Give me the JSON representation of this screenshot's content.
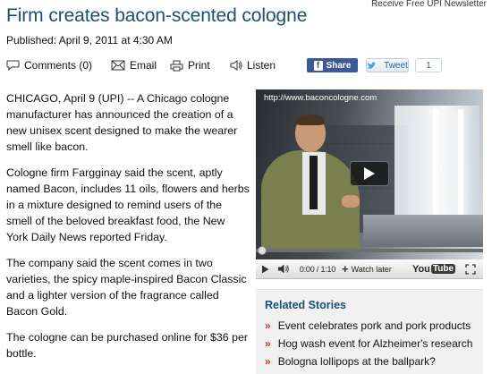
{
  "header": {
    "top_link": "Receive Free UPI Newsletter",
    "headline": "Firm creates bacon-scented cologne",
    "published": "Published: April 9, 2011 at 4:30 AM"
  },
  "toolbar": {
    "comments": "Comments (0)",
    "email": "Email",
    "print": "Print",
    "listen": "Listen",
    "share": "Share",
    "tweet": "Tweet",
    "tweet_count": "1",
    "colors": {
      "facebook": "#3b5998",
      "headline": "#1a4f7a"
    }
  },
  "article": {
    "paragraphs": [
      "CHICAGO, April 9 (UPI) -- A Chicago cologne manufacturer has announced the creation of a new unisex scent designed to make the wearer smell like bacon.",
      "Cologne firm Fargginay said the scent, aptly named Bacon, includes 11 oils, flowers and herbs in a mixture designed to remind users of the smell of the beloved breakfast food, the New York Daily News reported Friday.",
      "The company said the scent comes in two varieties, the spicy maple-inspired Bacon Classic and a lighter version of the fragrance called Bacon Gold.",
      "The cologne can be purchased online for $36 per bottle."
    ]
  },
  "video": {
    "url_overlay": "http://www.baconcologne.com",
    "time": "0:00 / 1:10",
    "watch_later": "Watch later",
    "youtube_you": "You",
    "youtube_tube": "Tube",
    "progress": 0
  },
  "related": {
    "title": "Related Stories",
    "bullet": "»",
    "items": [
      "Event celebrates pork and pork products",
      "Hog wash event for Alzheimer's research",
      "Bologna lollipops at the ballpark?"
    ]
  }
}
